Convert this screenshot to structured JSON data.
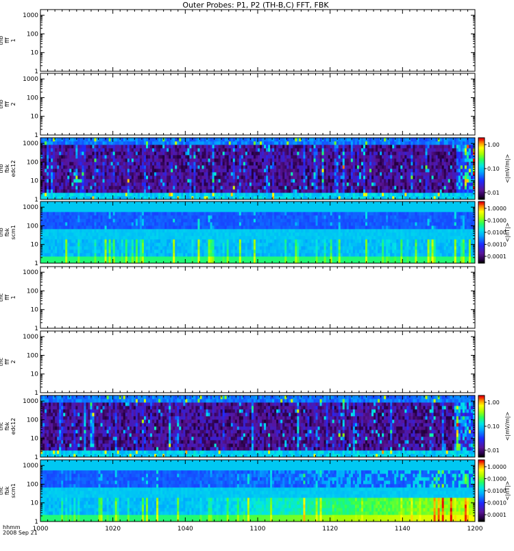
{
  "title": "Outer Probes: P1, P2 (TH-B,C) FFT, FBK",
  "chart_data": {
    "type": "heatmap",
    "x": {
      "ticks": [
        "1000",
        "1020",
        "1040",
        "1100",
        "1120",
        "1140",
        "1200"
      ],
      "footer_line1": "hhmm",
      "footer_line2": "2008 Sep 21"
    },
    "y_ticks": [
      "1",
      "10",
      "100",
      "1000"
    ],
    "panels": [
      {
        "label": [
          "thb",
          "fff",
          "1"
        ],
        "kind": "empty"
      },
      {
        "label": [
          "thb",
          "fff",
          "2"
        ],
        "kind": "empty"
      },
      {
        "label": [
          "thb",
          "fbk",
          "edc12"
        ],
        "kind": "spectrogram",
        "scheme": "edc",
        "seed": 11,
        "colorbar": {
          "title": "<|mV/m|>",
          "ticks": [
            "1.00",
            "0.10",
            "0.01"
          ]
        }
      },
      {
        "label": [
          "thb",
          "fbk",
          "scm1"
        ],
        "kind": "spectrogram",
        "scheme": "scm",
        "seed": 23,
        "colorbar": {
          "title": "<|nT|>",
          "ticks": [
            "1.0000",
            "0.1000",
            "0.0100",
            "0.0010",
            "0.0001"
          ]
        }
      },
      {
        "label": [
          "thc",
          "fff",
          "1"
        ],
        "kind": "empty"
      },
      {
        "label": [
          "thc",
          "fff",
          "2"
        ],
        "kind": "empty"
      },
      {
        "label": [
          "thc",
          "fbk",
          "edc12"
        ],
        "kind": "spectrogram",
        "scheme": "edc",
        "seed": 37,
        "colorbar": {
          "title": "<|mV/m|>",
          "ticks": [
            "1.00",
            "0.10",
            "0.01"
          ]
        }
      },
      {
        "label": [
          "thc",
          "fbk",
          "scm1"
        ],
        "kind": "spectrogram",
        "scheme": "scm2",
        "seed": 53,
        "colorbar": {
          "title": "<|nT|>",
          "ticks": [
            "1.0000",
            "0.1000",
            "0.0100",
            "0.0010",
            "0.0001"
          ]
        }
      }
    ]
  }
}
